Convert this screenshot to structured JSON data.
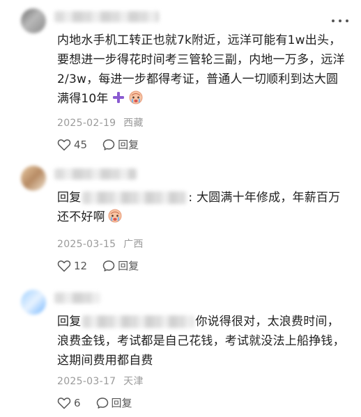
{
  "comments": [
    {
      "text": "内地水手机工转正也就7k附近，远洋可能有1w出头，要想进一步得花时间考三管轮三副，内地一万多，远洋2/3w，每进一步都得考证，普通人一切顺利到达大圆满得10年",
      "date": "2025-02-19",
      "location": "西藏",
      "likes": "45",
      "reply_label": "回复"
    },
    {
      "reply_prefix": "回复",
      "text": ": 大圆满十年修成，年薪百万还不好啊",
      "date": "2025-03-15",
      "location": "广西",
      "likes": "12",
      "reply_label": "回复"
    },
    {
      "reply_prefix": "回复",
      "text": "你说得很对，太浪费时间，浪费金钱，考试都是自己花钱，考试就没法上船挣钱，这期间费用都自费",
      "date": "2025-03-17",
      "location": "天津",
      "likes": "6",
      "reply_label": "回复"
    }
  ],
  "icons": {
    "like": "heart-outline-icon",
    "reply": "speech-bubble-icon",
    "more": "more-dots-icon",
    "emoji_plus": "purple-plus-emoji",
    "emoji_cry": "crying-face-emoji"
  },
  "colors": {
    "text": "#1f1f1f",
    "meta": "#9a9a9a",
    "plus": "#8a5bd1"
  }
}
